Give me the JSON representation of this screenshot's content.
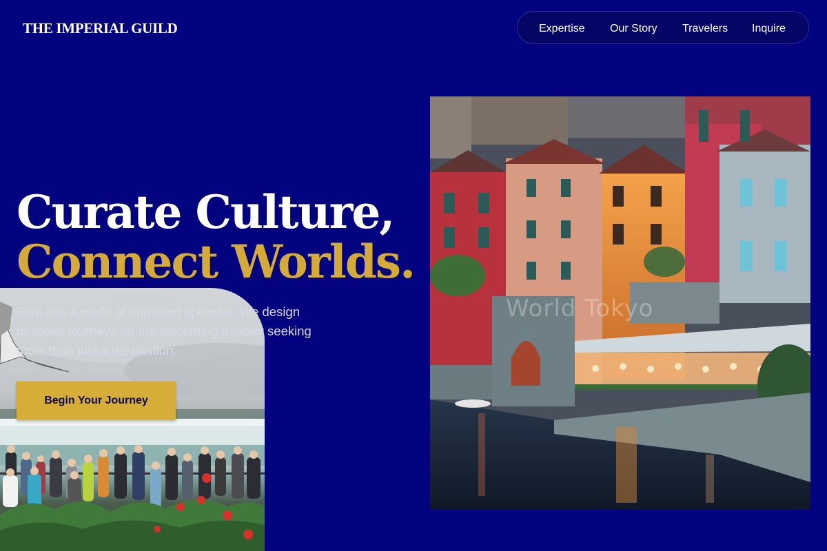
{
  "brand": {
    "logo": "THE IMPERIAL GUILD"
  },
  "nav": {
    "items": [
      {
        "label": "Expertise"
      },
      {
        "label": "Our Story"
      },
      {
        "label": "Travelers"
      },
      {
        "label": "Inquire"
      }
    ]
  },
  "hero": {
    "title_line1": "Curate Culture,",
    "title_line2": "Connect Worlds.",
    "description": "Step into a world of unrivaled splendor. We design bespoke journeys for the discerning traveler seeking more than just a destination.",
    "cta_label": "Begin Your Journey"
  },
  "images": {
    "small_photo": "waterfall-crowd-photo",
    "large_photo": "lakeside-village-photo",
    "watermark": "World Tokyo"
  },
  "colors": {
    "background": "#03037f",
    "accent_gold": "#d4aa3a",
    "nav_background": "#050565",
    "text_white": "#ffffff"
  }
}
